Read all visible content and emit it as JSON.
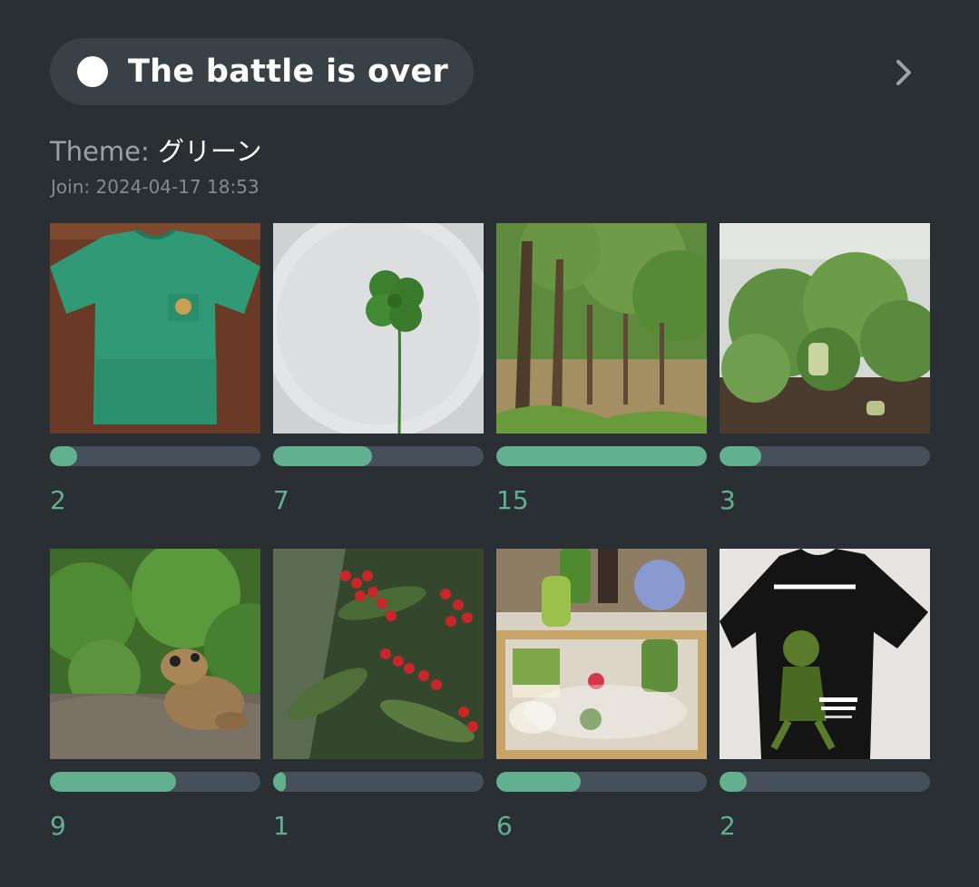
{
  "header": {
    "status_title": "The battle is over",
    "theme_label": "Theme: ",
    "theme_value": "グリーン",
    "join_text": "Join: 2024-04-17 18:53",
    "next_icon": "chevron-right-icon"
  },
  "colors": {
    "background": "#2a2f33",
    "pill": "#3a4146",
    "accent": "#62b08f",
    "track": "#46505a"
  },
  "entries": [
    {
      "subject": "green-t-shirt",
      "votes": "2",
      "progress": 0.13
    },
    {
      "subject": "four-leaf-clover",
      "votes": "7",
      "progress": 0.47
    },
    {
      "subject": "forest-trees",
      "votes": "15",
      "progress": 1.0
    },
    {
      "subject": "daikon-plants",
      "votes": "3",
      "progress": 0.2
    },
    {
      "subject": "frog-figurine",
      "votes": "9",
      "progress": 0.6
    },
    {
      "subject": "red-berries",
      "votes": "1",
      "progress": 0.06
    },
    {
      "subject": "matcha-dessert",
      "votes": "6",
      "progress": 0.4
    },
    {
      "subject": "black-t-shirt",
      "votes": "2",
      "progress": 0.13
    }
  ]
}
